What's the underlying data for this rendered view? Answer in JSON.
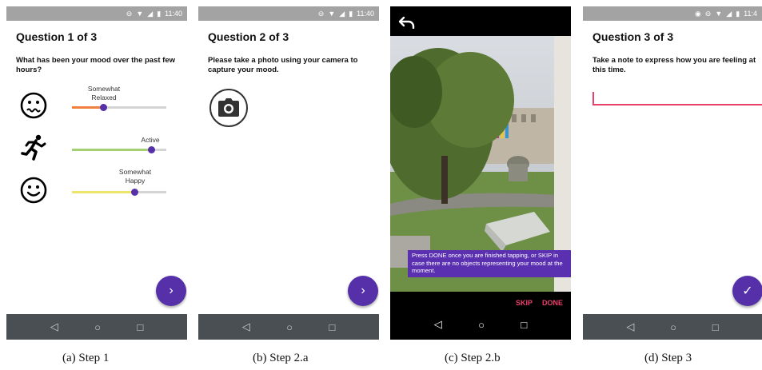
{
  "colors": {
    "accent": "#5630a8",
    "pink": "#e9416a",
    "statusbar": "#a3a3a3",
    "navbar": "#4a4f54"
  },
  "screens": [
    {
      "status_time": "11:40",
      "title": "Question 1 of 3",
      "question": "What has been your mood over the past few hours?",
      "sliders": [
        {
          "icon": "worried-face-icon",
          "label": "Somewhat Relaxed",
          "value": 0.33,
          "fill_color": "#f0803c"
        },
        {
          "icon": "running-person-icon",
          "label": "Active",
          "value": 0.84,
          "fill_color": "#a5cf73"
        },
        {
          "icon": "smiley-face-icon",
          "label": "Somewhat Happy",
          "value": 0.66,
          "fill_color": "#ece46b"
        }
      ],
      "fab_icon": "›"
    },
    {
      "status_time": "11:40",
      "title": "Question 2 of 3",
      "question": "Please take a photo using your camera to capture your mood.",
      "fab_icon": "›"
    },
    {
      "tooltip": "Press DONE once you are finished tapping, or SKIP in case there are no objects representing your mood at the moment.",
      "skip_label": "SKIP",
      "done_label": "DONE"
    },
    {
      "status_time": "11:4",
      "title": "Question 3 of 3",
      "question": "Take a note to express how you are feeling at this time.",
      "fab_icon": "✓"
    }
  ],
  "nav": {
    "back": "◁",
    "home": "○",
    "recents": "□"
  },
  "captions": [
    "(a) Step 1",
    "(b) Step 2.a",
    "(c) Step 2.b",
    "(d) Step 3"
  ]
}
